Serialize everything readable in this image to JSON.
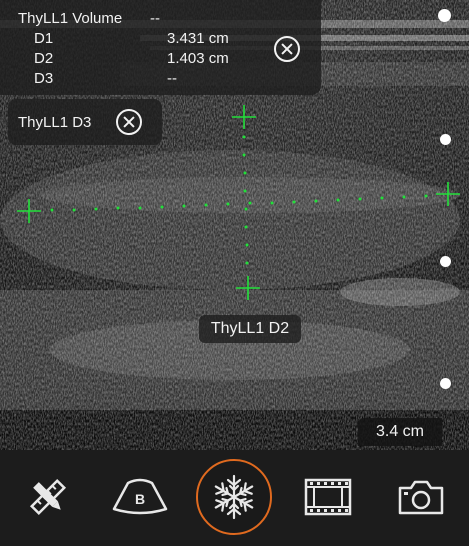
{
  "volume_panel": {
    "title": "ThyLL1 Volume",
    "title_value": "--",
    "measurements": [
      {
        "label": "D1",
        "value": "3.431 cm"
      },
      {
        "label": "D2",
        "value": "1.403 cm"
      },
      {
        "label": "D3",
        "value": "--"
      }
    ]
  },
  "d3_panel": {
    "label": "ThyLL1 D3"
  },
  "d2_label": "ThyLL1 D2",
  "depth": "3.4 cm",
  "colors": {
    "caliper": "#22e03a",
    "freeze_accent": "#e06a1f"
  },
  "toolbar": [
    {
      "name": "measure-tools",
      "icon": "ruler-pencil-icon"
    },
    {
      "name": "b-mode",
      "icon": "b-mode-probe-icon",
      "label": "B"
    },
    {
      "name": "freeze",
      "icon": "snowflake-icon",
      "active": true
    },
    {
      "name": "cine",
      "icon": "film-icon"
    },
    {
      "name": "capture",
      "icon": "camera-icon"
    }
  ]
}
